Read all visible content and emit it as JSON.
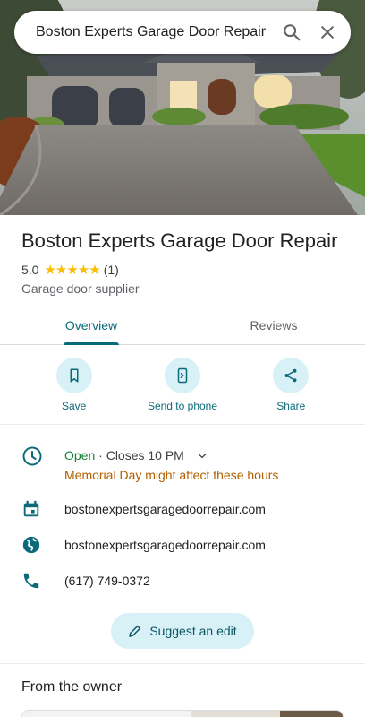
{
  "search": {
    "query": "Boston Experts Garage Door Repair"
  },
  "place": {
    "name": "Boston Experts Garage Door Repair",
    "rating": "5.0",
    "stars": "★★★★★",
    "review_count": "(1)",
    "category": "Garage door supplier"
  },
  "tabs": [
    {
      "label": "Overview"
    },
    {
      "label": "Reviews"
    }
  ],
  "actions": [
    {
      "label": "Save",
      "icon": "bookmark-icon"
    },
    {
      "label": "Send to phone",
      "icon": "send-to-phone-icon"
    },
    {
      "label": "Share",
      "icon": "share-icon"
    }
  ],
  "hours": {
    "status": "Open",
    "separator": " · ",
    "closes": "Closes 10 PM",
    "notice": "Memorial Day might affect these hours"
  },
  "details": {
    "booking": "bostonexpertsgaragedoorrepair.com",
    "website": "bostonexpertsgaragedoorrepair.com",
    "phone": "(617) 749-0372"
  },
  "suggest_edit": "Suggest an edit",
  "owner_section": {
    "title": "From the owner"
  },
  "colors": {
    "accent": "#0b6a7a",
    "open": "#188038",
    "warning": "#b06000",
    "star": "#fbbc04",
    "chip_bg": "#d7f1f7"
  }
}
